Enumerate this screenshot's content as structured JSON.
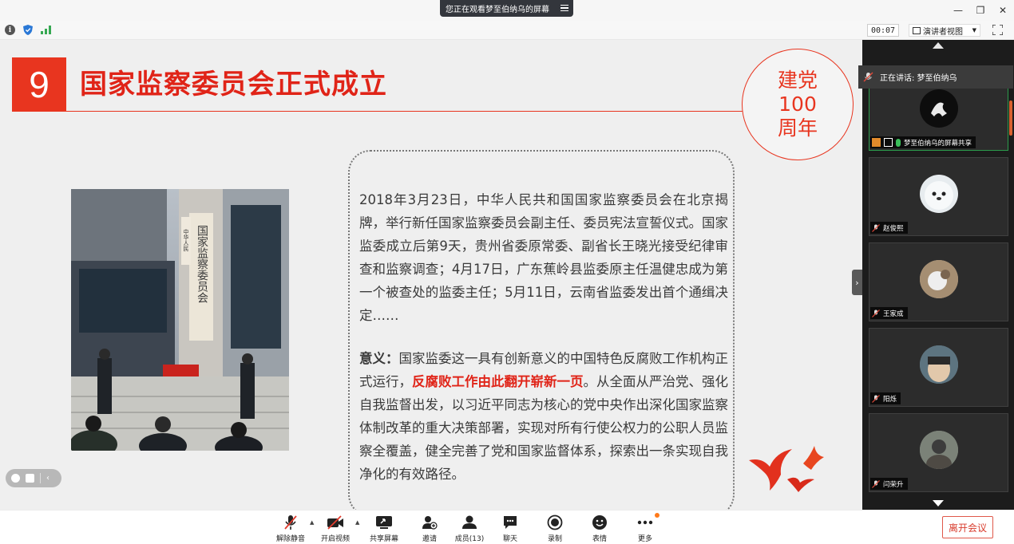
{
  "window": {
    "share_banner": "您正在观看梦至伯纳乌的屏幕",
    "controls": [
      "—",
      "❐",
      "✕"
    ]
  },
  "subbar": {
    "timer": "00:07",
    "view_mode": "演讲者视图"
  },
  "slide": {
    "number": "9",
    "title": "国家监察委员会正式成立",
    "badge": [
      "建党",
      "100",
      "周年"
    ],
    "photo_sign": "中华人民共和国国家监察委员会",
    "paragraph1": "2018年3月23日，中华人民共和国国家监察委员会在北京揭牌，举行新任国家监察委员会副主任、委员宪法宣誓仪式。国家监委成立后第9天，贵州省委原常委、副省长王晓光接受纪律审查和监察调查；4月17日，广东蕉岭县监委原主任温健忠成为第一个被查处的监委主任；5月11日，云南省监委发出首个通缉决定……",
    "paragraph2_label": "意义：",
    "paragraph2_a": "国家监委这一具有创新意义的中国特色反腐败工作机构正式运行，",
    "paragraph2_red": "反腐败工作由此翻开崭新一页",
    "paragraph2_b": "。从全面从严治党、强化自我监督出发，以习近平同志为核心的党中央作出深化国家监察体制改革的重大决策部署，实现对所有行使公权力的公职人员监察全覆盖，健全完善了党和国家监督体系，探索出一条实现自我净化的有效路径。"
  },
  "panel": {
    "speaking": "正在讲话: 梦至伯纳乌",
    "participants": [
      {
        "name": "梦至伯纳乌的屏幕共享",
        "active": true
      },
      {
        "name": "赵俊熙",
        "active": false
      },
      {
        "name": "王家成",
        "active": false
      },
      {
        "name": "阳烁",
        "active": false
      },
      {
        "name": "闫荣升",
        "active": false
      }
    ]
  },
  "toolbar": {
    "mute": "解除静音",
    "video": "开启视频",
    "share": "共享屏幕",
    "invite": "邀请",
    "members": "成员(13)",
    "chat": "聊天",
    "record": "录制",
    "emoji": "表情",
    "more": "更多",
    "leave": "离开会议"
  },
  "colors": {
    "accent_red": "#e8351f",
    "panel_bg": "#1c1c1c",
    "active_border": "#2c9c4c"
  }
}
